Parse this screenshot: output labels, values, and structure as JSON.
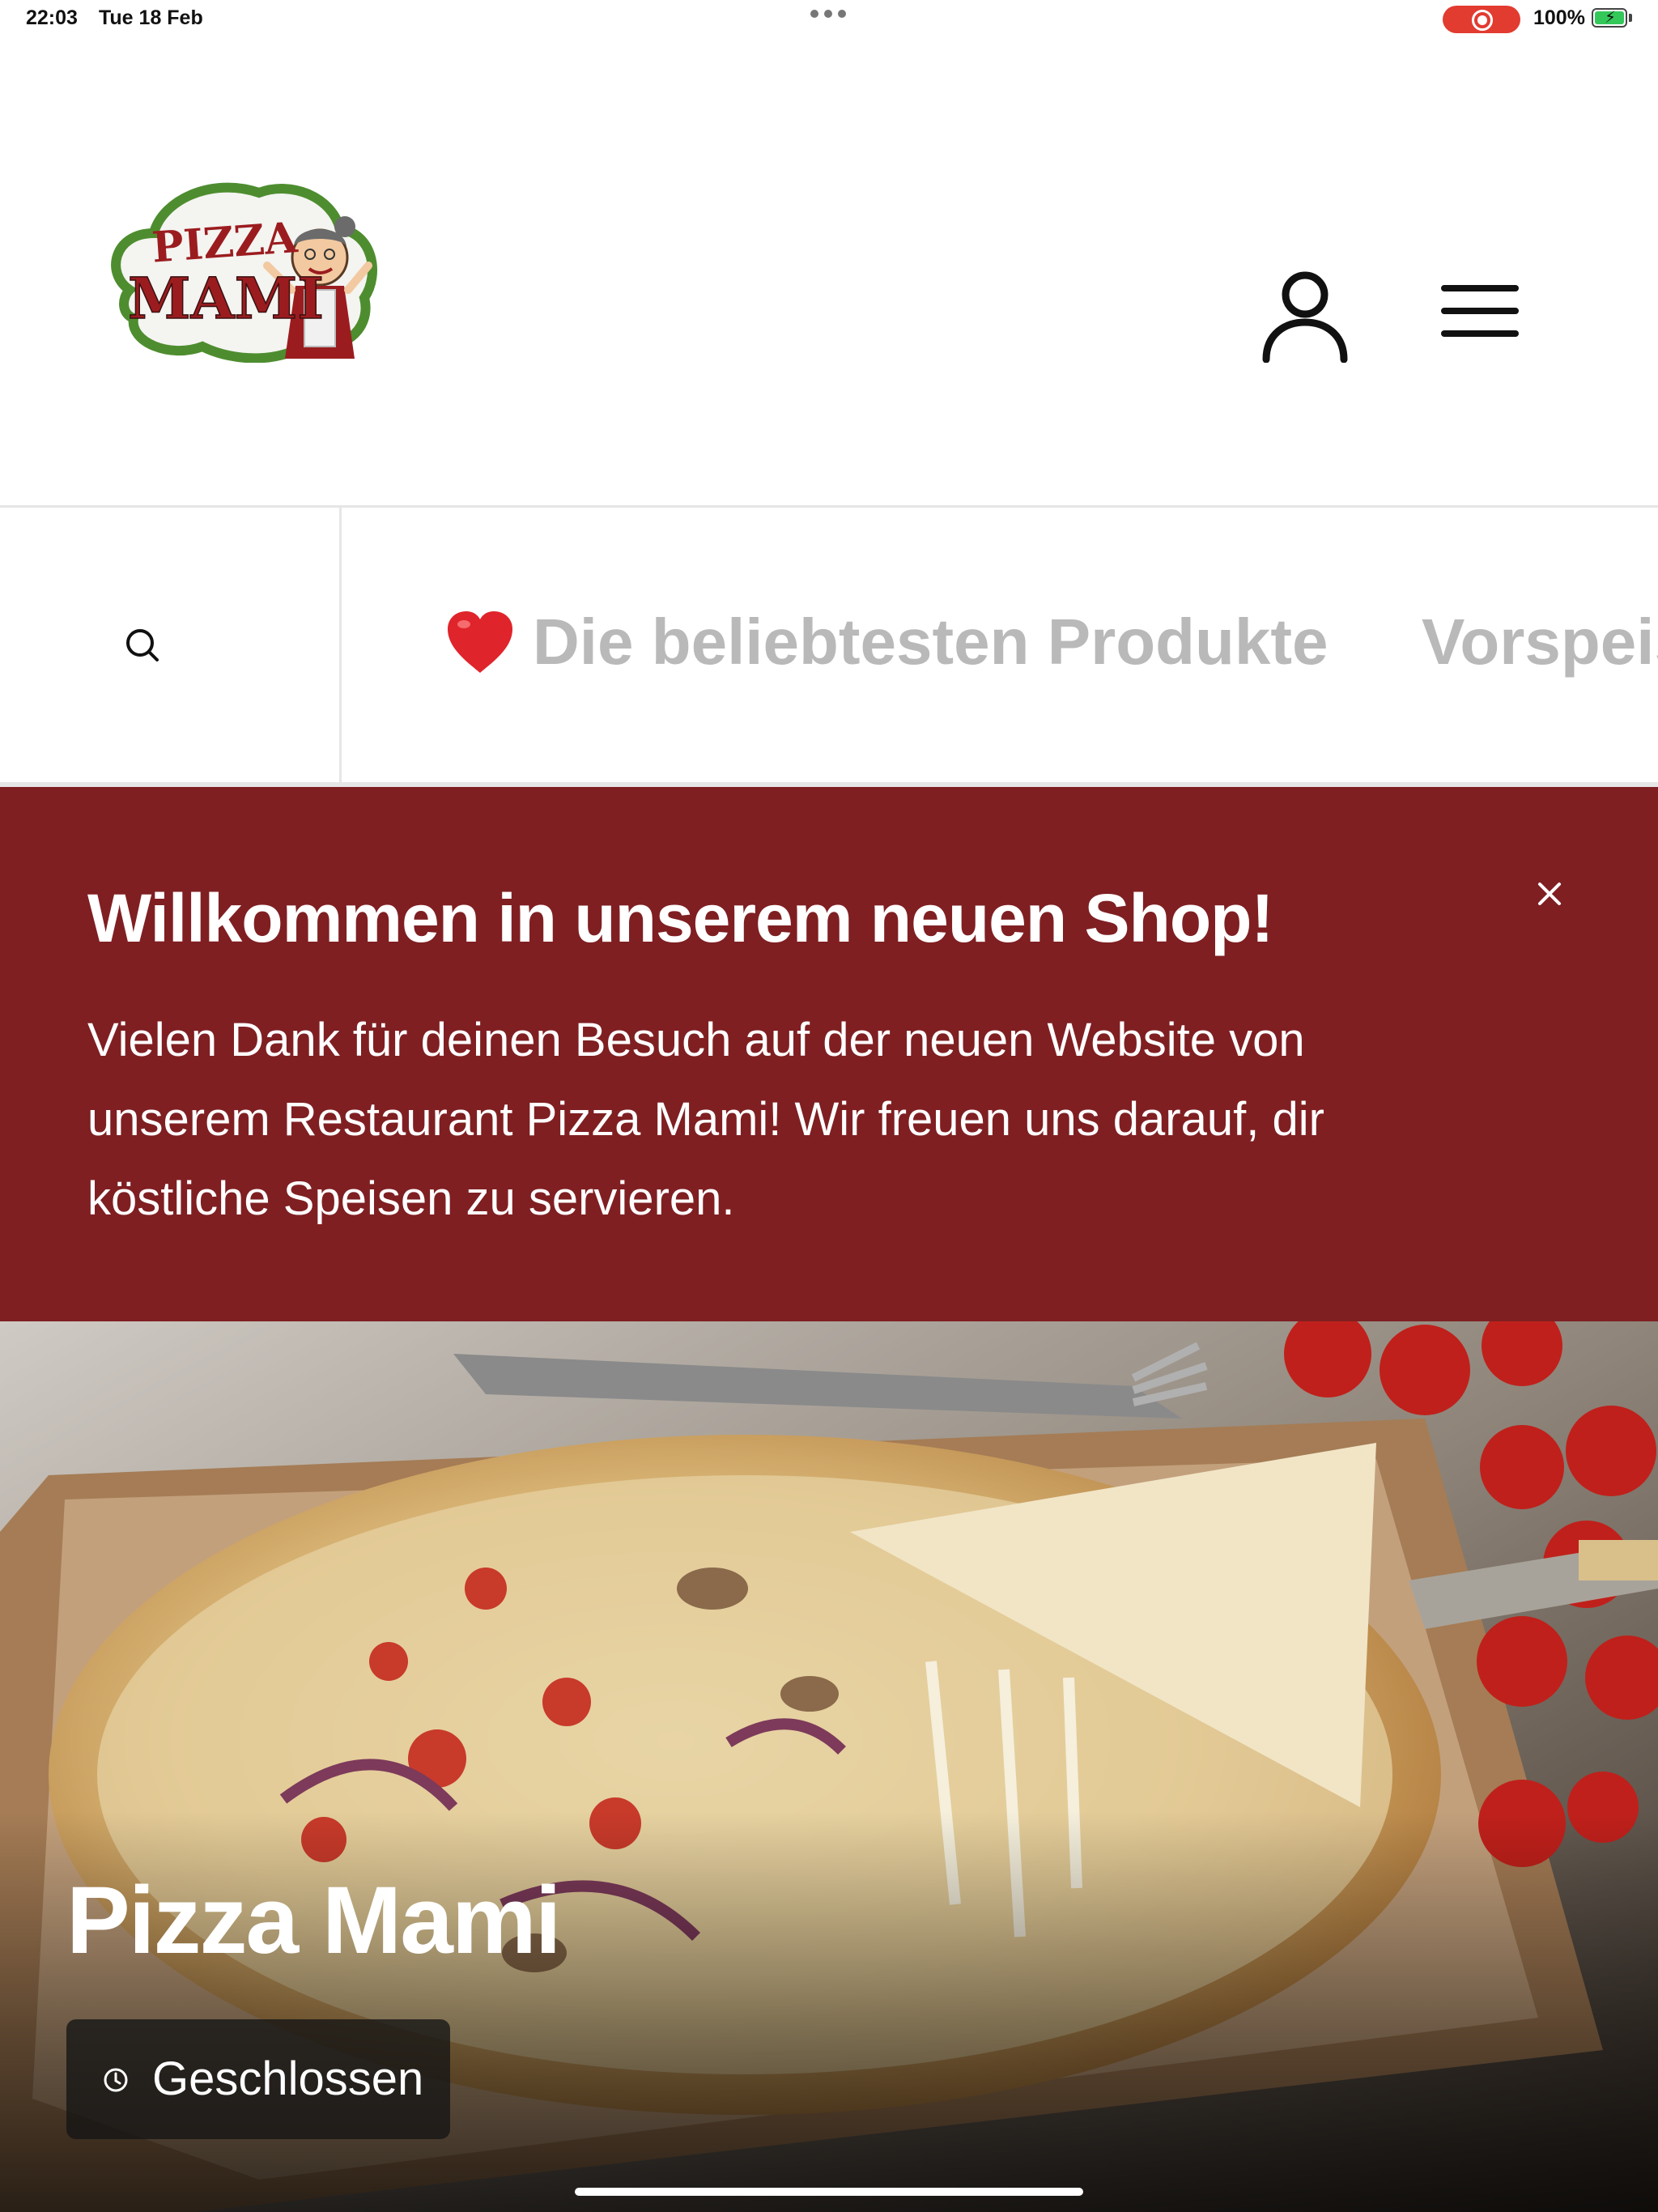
{
  "status_bar": {
    "time": "22:03",
    "date": "Tue 18 Feb",
    "battery": "100%"
  },
  "header": {
    "logo_text_line1": "PIZZA",
    "logo_text_line2": "MAMI",
    "account_icon": "user-icon",
    "menu_icon": "hamburger-menu-icon"
  },
  "category_nav": {
    "search_icon": "search-icon",
    "items": [
      {
        "emoji": "❤️",
        "label": "Die beliebtesten Produkte"
      },
      {
        "label": "Vorspeisen"
      }
    ]
  },
  "welcome_banner": {
    "title": "Willkommen in unserem neuen Shop!",
    "text": "Vielen Dank für deinen Besuch auf der neuen Website von unserem Restaurant Pizza Mami! Wir freuen uns darauf, dir köstliche Speisen zu servieren.",
    "close_icon": "close-icon"
  },
  "hero": {
    "title": "Pizza Mami",
    "status": "Geschlossen",
    "status_icon": "clock-icon"
  },
  "colors": {
    "banner_bg": "#7f1f22",
    "category_text": "#b9b9b9",
    "logo_green": "#4e8d2f",
    "logo_red": "#9b1c1f"
  }
}
